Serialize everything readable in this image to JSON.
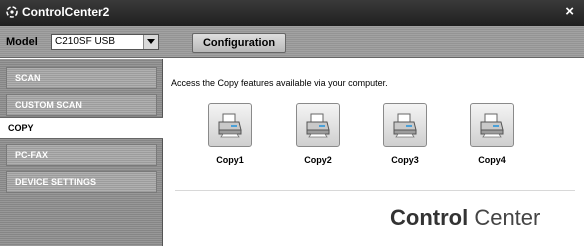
{
  "window": {
    "title": "ControlCenter2",
    "close_label": "×"
  },
  "toolbar": {
    "model_label": "Model",
    "model_value": "C210SF USB",
    "configuration_label": "Configuration"
  },
  "sidebar": {
    "items": [
      {
        "label": "SCAN",
        "active": false
      },
      {
        "label": "CUSTOM SCAN",
        "active": false
      },
      {
        "label": "COPY",
        "active": true
      },
      {
        "label": "PC-FAX",
        "active": false
      },
      {
        "label": "DEVICE SETTINGS",
        "active": false
      }
    ]
  },
  "main": {
    "description": "Access the Copy features available via your computer.",
    "copy_buttons": [
      {
        "label": "Copy1",
        "icon": "printer-icon"
      },
      {
        "label": "Copy2",
        "icon": "printer-icon"
      },
      {
        "label": "Copy3",
        "icon": "printer-icon"
      },
      {
        "label": "Copy4",
        "icon": "printer-icon"
      }
    ],
    "brand": {
      "bold": "Control",
      "light": " Center"
    }
  }
}
